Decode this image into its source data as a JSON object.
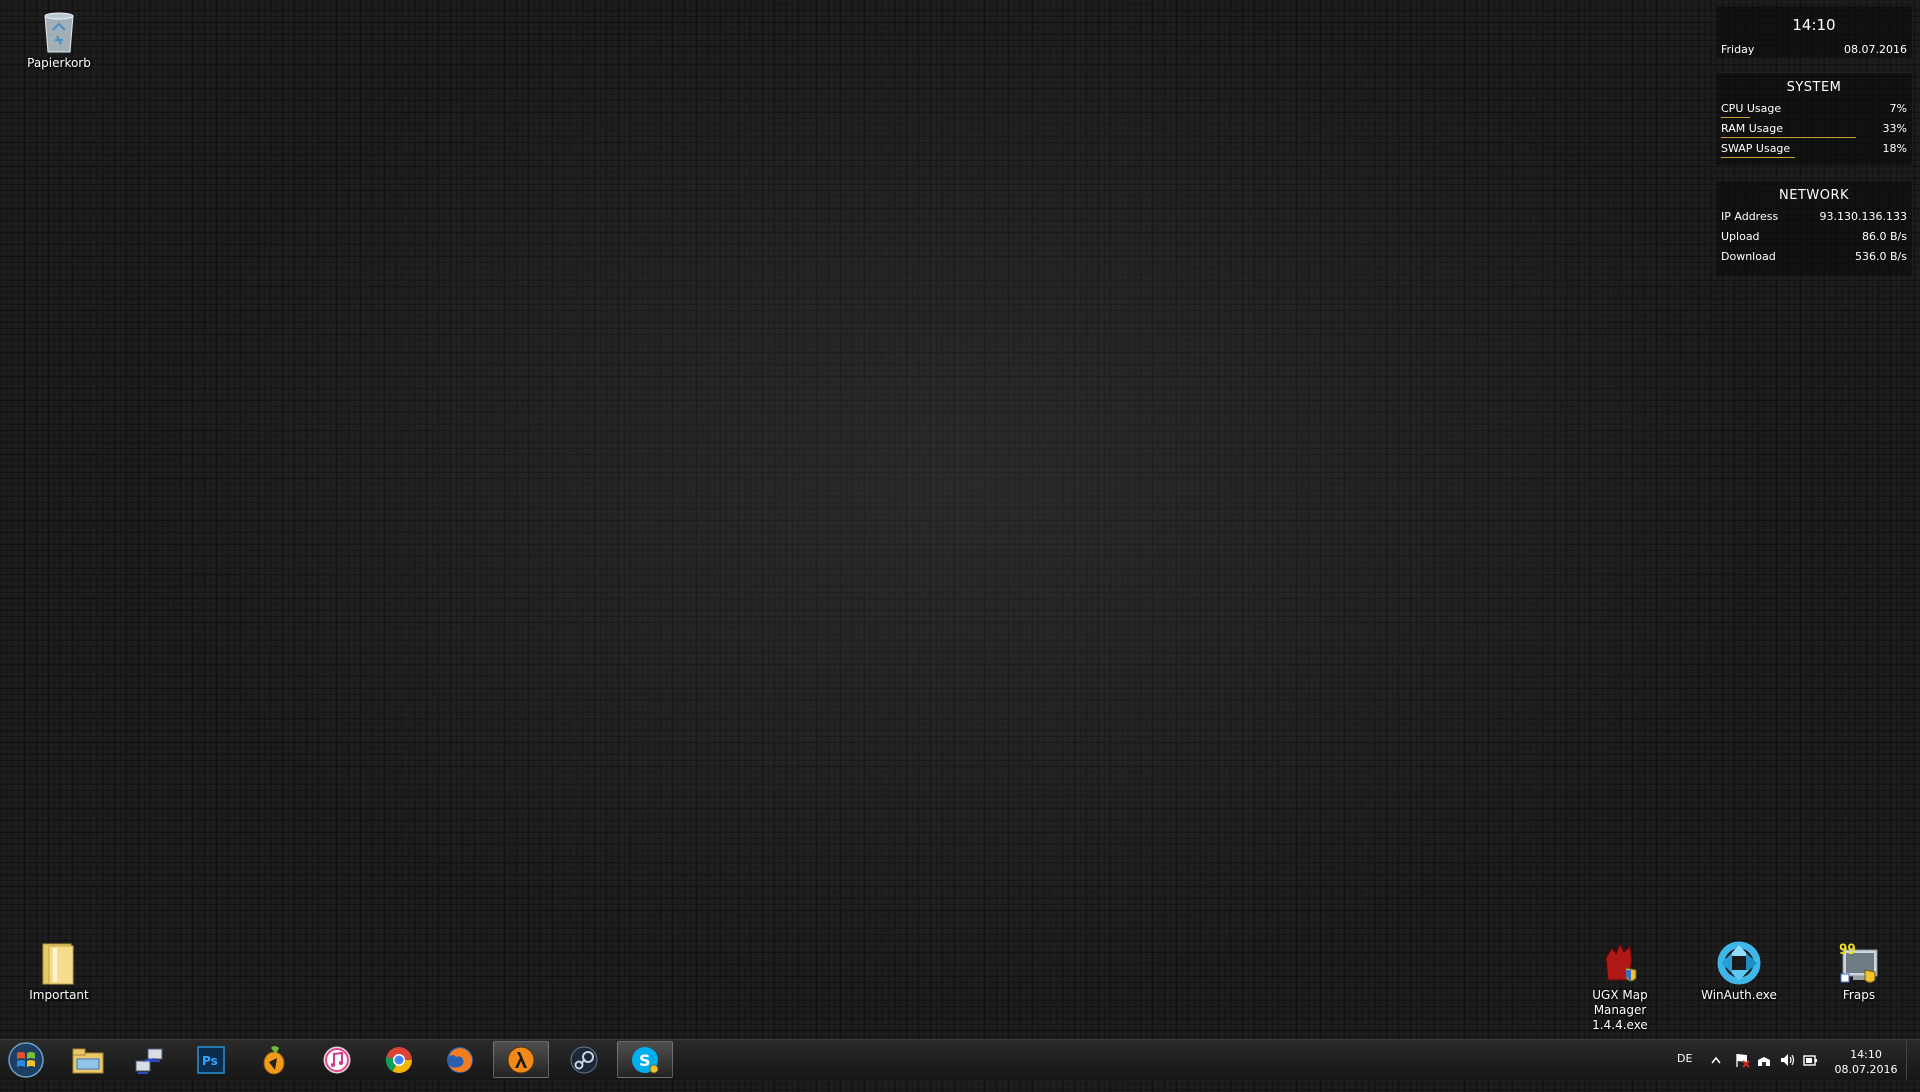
{
  "desktop": {
    "icons_left": [
      {
        "label": "Papierkorb",
        "icon": "recycle-bin-icon"
      },
      {
        "label": "Important",
        "icon": "folder-icon"
      }
    ],
    "icons_right": [
      {
        "label": "UGX Map Manager 1.4.4.exe",
        "line1": "UGX Map Manager",
        "line2": "1.4.4.exe",
        "icon": "ugx-map-manager-icon"
      },
      {
        "label": "WinAuth.exe",
        "icon": "winauth-icon"
      },
      {
        "label": "Fraps",
        "icon": "fraps-icon"
      }
    ]
  },
  "widgets": {
    "clock": {
      "time": "14:10",
      "day": "Friday",
      "date": "08.07.2016"
    },
    "system": {
      "title": "SYSTEM",
      "rows": [
        {
          "label": "CPU Usage",
          "value": "7%",
          "fraction": 0.07
        },
        {
          "label": "RAM Usage",
          "value": "33%",
          "fraction": 0.33
        },
        {
          "label": "SWAP Usage",
          "value": "18%",
          "fraction": 0.18
        }
      ]
    },
    "network": {
      "title": "NETWORK",
      "rows": [
        {
          "label": "IP Address",
          "value": "93.130.136.133"
        },
        {
          "label": "Upload",
          "value": "86.0 B/s"
        },
        {
          "label": "Download",
          "value": "536.0 B/s"
        }
      ]
    }
  },
  "taskbar": {
    "pinned": [
      {
        "icon": "file-explorer-icon"
      },
      {
        "icon": "network-tool-icon"
      },
      {
        "icon": "photoshop-icon",
        "text": "Ps"
      },
      {
        "icon": "fl-studio-icon"
      },
      {
        "icon": "itunes-icon"
      },
      {
        "icon": "chrome-icon"
      },
      {
        "icon": "firefox-icon"
      },
      {
        "icon": "half-life-icon"
      },
      {
        "icon": "steam-icon"
      },
      {
        "icon": "skype-icon",
        "text": "S"
      }
    ],
    "tray": {
      "language": "DE",
      "time": "14:10",
      "date": "08.07.2016",
      "icons": [
        "show-hidden-icons-icon",
        "action-center-flag-icon",
        "network-icon",
        "volume-icon",
        "power-icon"
      ]
    }
  },
  "colors": {
    "accent_bar": "#c9a23b",
    "background": "#1d1d1d"
  }
}
